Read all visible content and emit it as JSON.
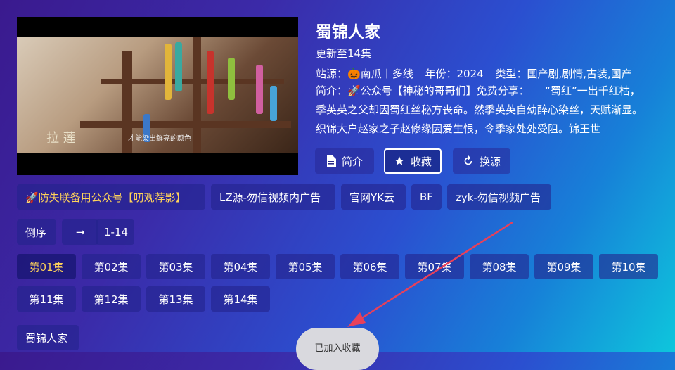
{
  "detail": {
    "title": "蜀锦人家",
    "update": "更新至14集",
    "meta_site_label": "站源：",
    "meta_site_icon": "pumpkin-icon",
    "meta_site_name": "南瓜丨多线",
    "meta_year_label": "年份：",
    "meta_year": "2024",
    "meta_type_label": "类型：",
    "meta_type": "国产剧,剧情,古装,国产",
    "desc": "简介：🚀公众号【神秘的哥哥们】免费分享：　　“蜀红”一出千红枯，季英英之父却因蜀红丝秘方丧命。然季英英自幼醉心染丝，天赋渐显。织锦大户赵家之子赵修缘因爱生恨，令季家处处受阻。锦王世"
  },
  "poster": {
    "subtitle": "才能染出鲜亮的颜色",
    "calligraphy": "拉 莲"
  },
  "actions": [
    {
      "label": "简介",
      "icon": "document-icon"
    },
    {
      "label": "收藏",
      "icon": "star-icon"
    },
    {
      "label": "换源",
      "icon": "refresh-icon"
    }
  ],
  "sources": [
    "🚀防失联备用公众号【叨观荐影】",
    "LZ源-勿信视频内广告",
    "官网YK云",
    "BF",
    "zyk-勿信视频广告"
  ],
  "controls": {
    "order": "倒序",
    "arrow": "→",
    "range": "1-14"
  },
  "episodes": [
    "第01集",
    "第02集",
    "第03集",
    "第04集",
    "第05集",
    "第06集",
    "第07集",
    "第08集",
    "第09集",
    "第10集",
    "第11集",
    "第12集",
    "第13集",
    "第14集"
  ],
  "footer_title": "蜀锦人家",
  "toast": "已加入收藏",
  "colors": {
    "active_text": "#ffd35a",
    "annotation_arrow": "#e8405a"
  }
}
